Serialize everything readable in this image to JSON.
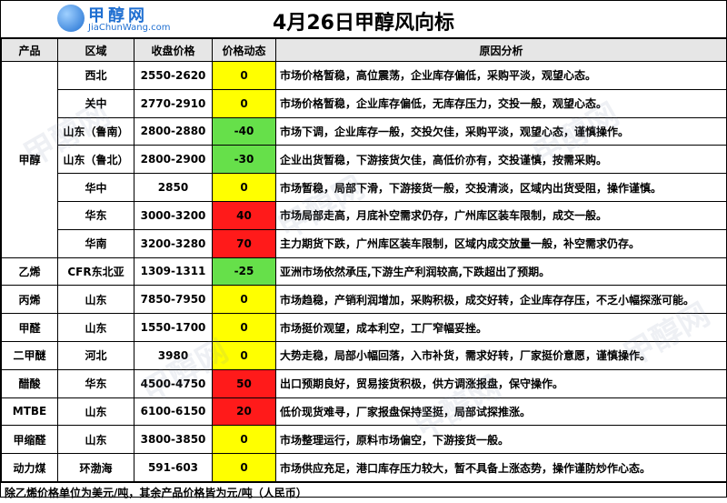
{
  "logo": {
    "cn": "甲醇网",
    "en": "JiaChunWang.com"
  },
  "title": "4月26日甲醇风向标",
  "headers": [
    "产品",
    "区域",
    "收盘价格",
    "价格动态",
    "原因分析"
  ],
  "rows": [
    {
      "product": "甲醇",
      "region": "西北",
      "price": "2550-2620",
      "change": "0",
      "color": "yellow",
      "reason": "市场价格暂稳，高位震荡，企业库存偏低，采购平淡，观望心态。"
    },
    {
      "product": "",
      "region": "关中",
      "price": "2770-2910",
      "change": "0",
      "color": "yellow",
      "reason": "市场价格暂稳，企业库存偏低，无库存压力，交投一般，观望心态。"
    },
    {
      "product": "",
      "region": "山东（鲁南）",
      "price": "2800-2880",
      "change": "-40",
      "color": "green",
      "reason": "市场下调，企业库存一般，交投欠佳，采购平淡，观望心态，谨慎操作。"
    },
    {
      "product": "",
      "region": "山东（鲁北）",
      "price": "2800-2900",
      "change": "-30",
      "color": "green",
      "reason": "企业出货暂稳，下游接货欠佳，高低价亦有，交投谨慎，按需采购。"
    },
    {
      "product": "",
      "region": "华中",
      "price": "2850",
      "change": "0",
      "color": "yellow",
      "reason": "市场暂稳，局部下滑，下游接货一般，交投清淡，区域内出货受阻，操作谨慎。"
    },
    {
      "product": "",
      "region": "华东",
      "price": "3000-3200",
      "change": "40",
      "color": "red",
      "reason": "市场局部走高，月底补空需求仍存，广州库区装车限制，成交一般。"
    },
    {
      "product": "",
      "region": "华南",
      "price": "3200-3280",
      "change": "70",
      "color": "red",
      "reason": "主力期货下跌，广州库区装车限制，区域内成交放量一般，补空需求仍存。"
    },
    {
      "product": "乙烯",
      "region": "CFR东北亚",
      "price": "1309-1311",
      "change": "-25",
      "color": "green",
      "reason": "亚洲市场依然承压,下游生产利润较高,下跌超出了预期。"
    },
    {
      "product": "丙烯",
      "region": "山东",
      "price": "7850-7950",
      "change": "0",
      "color": "yellow",
      "reason": "市场趋稳，产销利润增加，采购积极，成交好转，企业库存存压，不乏小幅探涨可能。"
    },
    {
      "product": "甲醛",
      "region": "山东",
      "price": "1550-1700",
      "change": "0",
      "color": "yellow",
      "reason": "市场挺价观望，成本利空，工厂窄幅妥挫。"
    },
    {
      "product": "二甲醚",
      "region": "河北",
      "price": "3980",
      "change": "0",
      "color": "yellow",
      "reason": "大势走稳，局部小幅回落，入市补货，需求好转，厂家挺价意愿，谨慎操作。"
    },
    {
      "product": "醋酸",
      "region": "华东",
      "price": "4500-4750",
      "change": "50",
      "color": "red",
      "reason": "出口预期良好，贸易接货积极，供方调涨报盘，保守操作。"
    },
    {
      "product": "MTBE",
      "region": "山东",
      "price": "6100-6150",
      "change": "20",
      "color": "red",
      "reason": "低价现货难寻，厂家报盘保持坚挺，局部试探推涨。"
    },
    {
      "product": "甲缩醛",
      "region": "山东",
      "price": "3800-3850",
      "change": "0",
      "color": "yellow",
      "reason": "市场整理运行，原料市场偏空，下游接货一般。"
    },
    {
      "product": "动力煤",
      "region": "环渤海",
      "price": "591-603",
      "change": "0",
      "color": "yellow",
      "reason": "市场供应充足，港口库存压力较大，暂不具备上涨态势，操作谨防炒作心态。"
    }
  ],
  "footer": "除乙烯价格单位为美元/吨，其余产品价格皆为元/吨（人民币）",
  "colors": {
    "yellow": "#ffff00",
    "green": "#66e04a",
    "red": "#ff1a1a"
  }
}
